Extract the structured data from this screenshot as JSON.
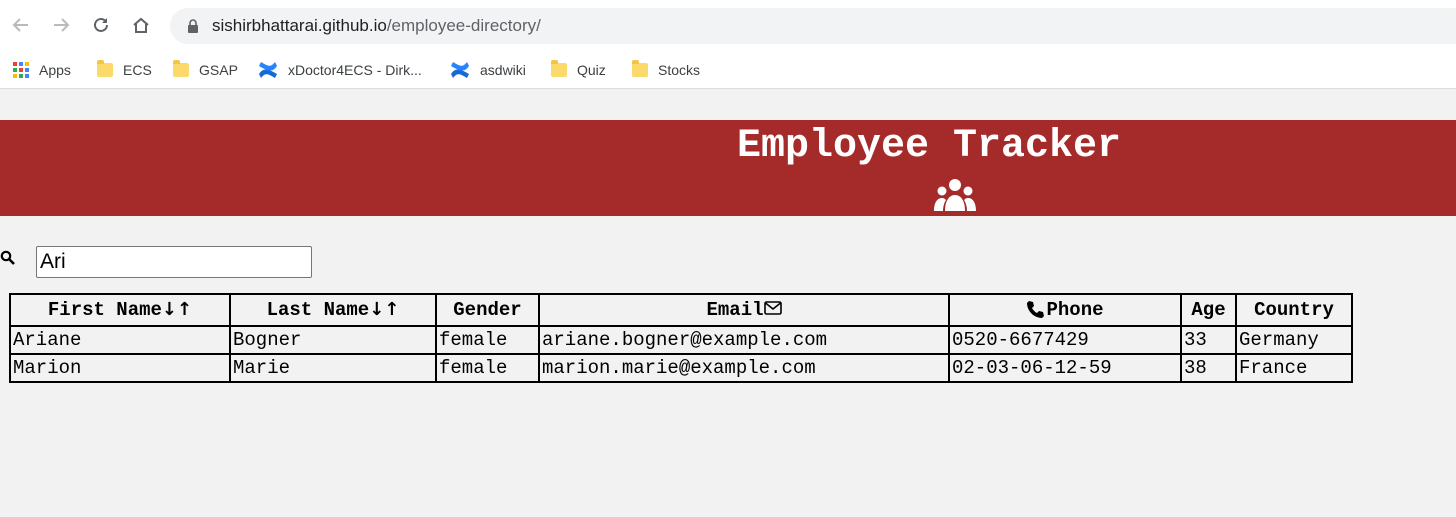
{
  "browser": {
    "url_domain": "sishirbhattarai.github.io",
    "url_path": "/employee-directory/",
    "nav_icons": [
      "back-icon",
      "forward-icon",
      "reload-icon",
      "home-icon"
    ],
    "bookmarks": [
      {
        "label": "Apps",
        "icon": "apps-grid-icon"
      },
      {
        "label": "ECS",
        "icon": "folder-icon"
      },
      {
        "label": "GSAP",
        "icon": "folder-icon"
      },
      {
        "label": "xDoctor4ECS - Dirk...",
        "icon": "confluence-icon"
      },
      {
        "label": "asdwiki",
        "icon": "confluence-icon"
      },
      {
        "label": "Quiz",
        "icon": "folder-icon"
      },
      {
        "label": "Stocks",
        "icon": "folder-icon"
      }
    ]
  },
  "header": {
    "title": "Employee Tracker",
    "icon": "users-icon",
    "background": "#a52a2a"
  },
  "search": {
    "value": "Ari",
    "icon": "search-icon"
  },
  "table": {
    "columns": {
      "first_name": "First Name",
      "last_name": "Last Name",
      "gender": "Gender",
      "email": "Email",
      "phone": "Phone",
      "age": "Age",
      "country": "Country"
    },
    "sort_down": "↓",
    "sort_up": "↑",
    "rows": [
      {
        "first_name": "Ariane",
        "last_name": "Bogner",
        "gender": "female",
        "email": "ariane.bogner@example.com",
        "phone": "0520-6677429",
        "age": "33",
        "country": "Germany"
      },
      {
        "first_name": "Marion",
        "last_name": "Marie",
        "gender": "female",
        "email": "marion.marie@example.com",
        "phone": "02-03-06-12-59",
        "age": "38",
        "country": "France"
      }
    ]
  }
}
